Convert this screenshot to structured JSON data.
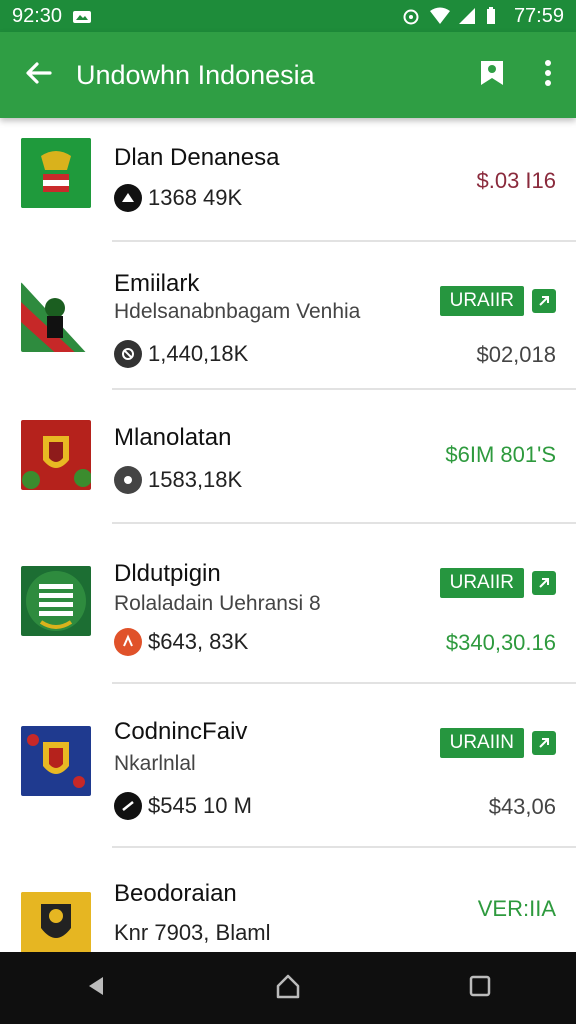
{
  "status_bar": {
    "time_left": "92:30",
    "time_right": "77:59",
    "icons": [
      "notification-icon",
      "alarm-icon",
      "wifi-icon",
      "signal-icon",
      "battery-icon"
    ]
  },
  "app_bar": {
    "title": "Undowhn Indonesia",
    "icons": [
      "back-arrow-icon",
      "bookmark-icon",
      "more-vert-icon"
    ]
  },
  "list": [
    {
      "title": "Dlan Denanesa",
      "subtitle": "",
      "stat": "1368 49K",
      "price": "$.03 I16",
      "action": ""
    },
    {
      "title": "Emiilark",
      "subtitle": "Hdelsanabnbagam Venhia",
      "stat": "1,440,18K",
      "price": "$02,018",
      "action": "URAIIR"
    },
    {
      "title": "Mlanolatan",
      "subtitle": "",
      "stat": "1583,18K",
      "price": "$6IM 801'S",
      "action": ""
    },
    {
      "title": "Dldutpigin",
      "subtitle": "Rolaladain Uehransi 8",
      "stat": "$643, 83K",
      "price": "$340,30.16",
      "action": "URAIIR"
    },
    {
      "title": "CodnincFaiv",
      "subtitle": "Nkarlnlal",
      "stat": "$545 10 M",
      "price": "$43,06",
      "action": "URAIIN"
    },
    {
      "title": "Beodoraian",
      "subtitle": "Knr 7903, Blaml",
      "stat": "",
      "price": "",
      "action": "VER:IIA"
    }
  ],
  "colors": {
    "primary": "#2f9e44",
    "status": "#1e8c3a",
    "price_red": "#8a2a3c",
    "price_green": "#2e9a3e"
  }
}
